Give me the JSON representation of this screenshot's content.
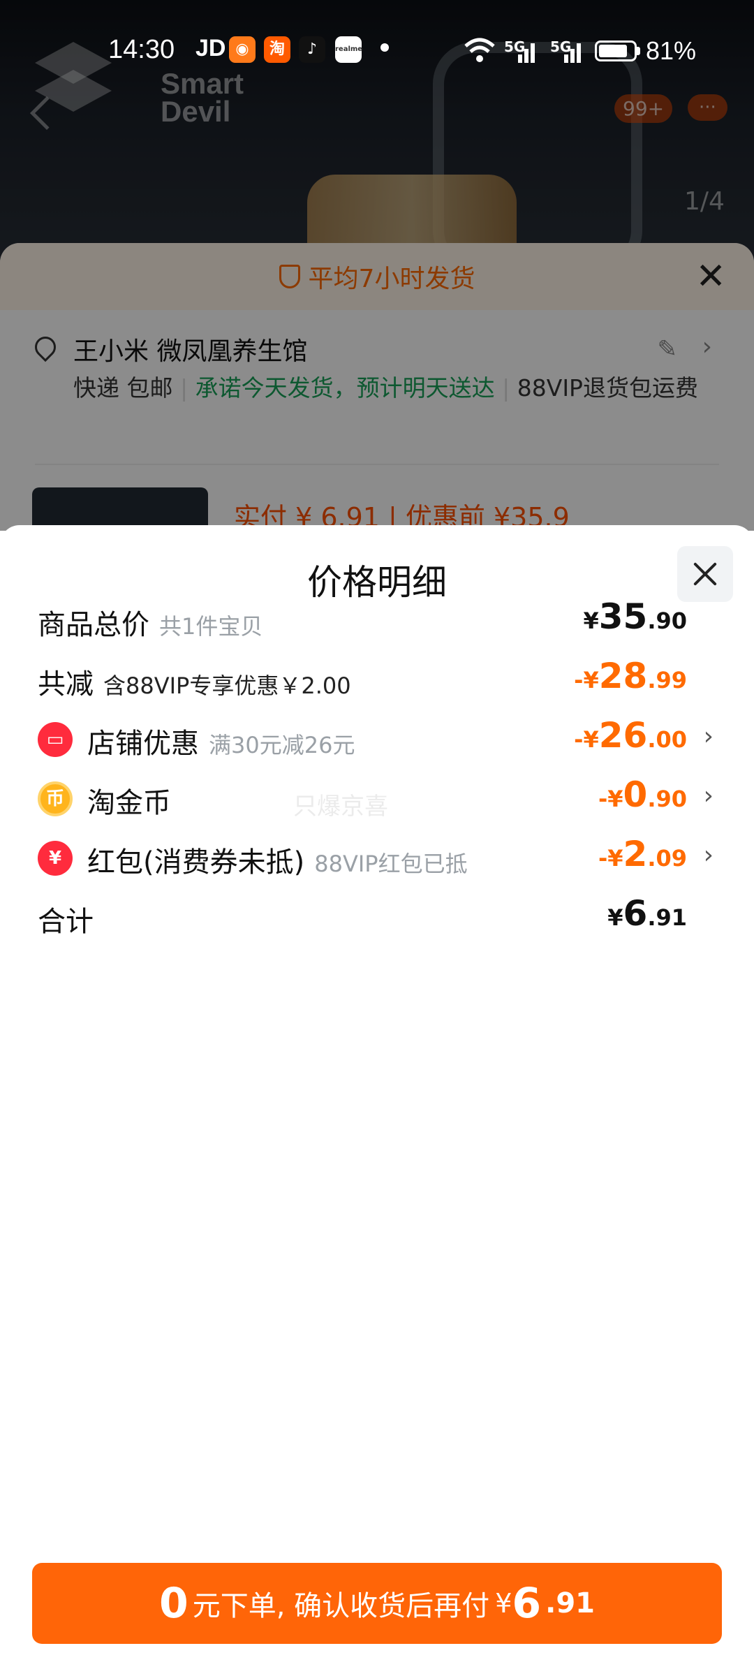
{
  "status_bar": {
    "time": "14:30",
    "carrier_app": "JD",
    "notif_apps": [
      "jd-app-icon",
      "taobao-icon",
      "tiktok-icon",
      "realme-icon"
    ],
    "taobao_char": "淘",
    "battery": "81%",
    "network": [
      "5G",
      "5G"
    ]
  },
  "background": {
    "brand": "Smart\nDevil",
    "cart_badge": "99+",
    "more": "···",
    "pager": "1/4"
  },
  "order_sheet": {
    "banner": "平均7小时发货",
    "address_name": "王小米 微凤凰养生馆",
    "delivery_prefix": "快递 包邮",
    "delivery_promise": "承诺今天发货，预计明天送达",
    "vip_return": "88VIP退货包运费",
    "paid_label": "实付 ¥ 6.91 | 优惠前 ¥35.9"
  },
  "modal": {
    "title": "价格明细",
    "rows": [
      {
        "label": "商品总价",
        "sub": "共1件宝贝",
        "currency": "¥",
        "int": "35",
        "dec": ".90",
        "color": "#111111"
      },
      {
        "label": "共减",
        "sub": "含88VIP专享优惠￥2.00",
        "currency": "-¥",
        "int": "28",
        "dec": ".99",
        "color": "#ff6a00"
      },
      {
        "label": "店铺优惠",
        "sub": "满30元减26元",
        "currency": "-¥",
        "int": "26",
        "dec": ".00",
        "color": "#ff6a00",
        "icon": "shop-icon"
      },
      {
        "label": "淘金币",
        "sub": "",
        "currency": "-¥",
        "int": "0",
        "dec": ".90",
        "color": "#ff6a00",
        "icon": "coin-icon"
      },
      {
        "label": "红包(消费券未抵)",
        "sub": "88VIP红包已抵",
        "currency": "-¥",
        "int": "2",
        "dec": ".09",
        "color": "#ff6a00",
        "icon": "red-packet-icon"
      },
      {
        "label": "合计",
        "sub": "",
        "currency": "¥",
        "int": "6",
        "dec": ".91",
        "color": "#111111"
      }
    ],
    "watermark": "只爆京喜",
    "cta": {
      "big": "0",
      "text": "元下单, 确认收货后再付",
      "currency": "¥",
      "int": "6",
      "dec": ".91"
    }
  }
}
